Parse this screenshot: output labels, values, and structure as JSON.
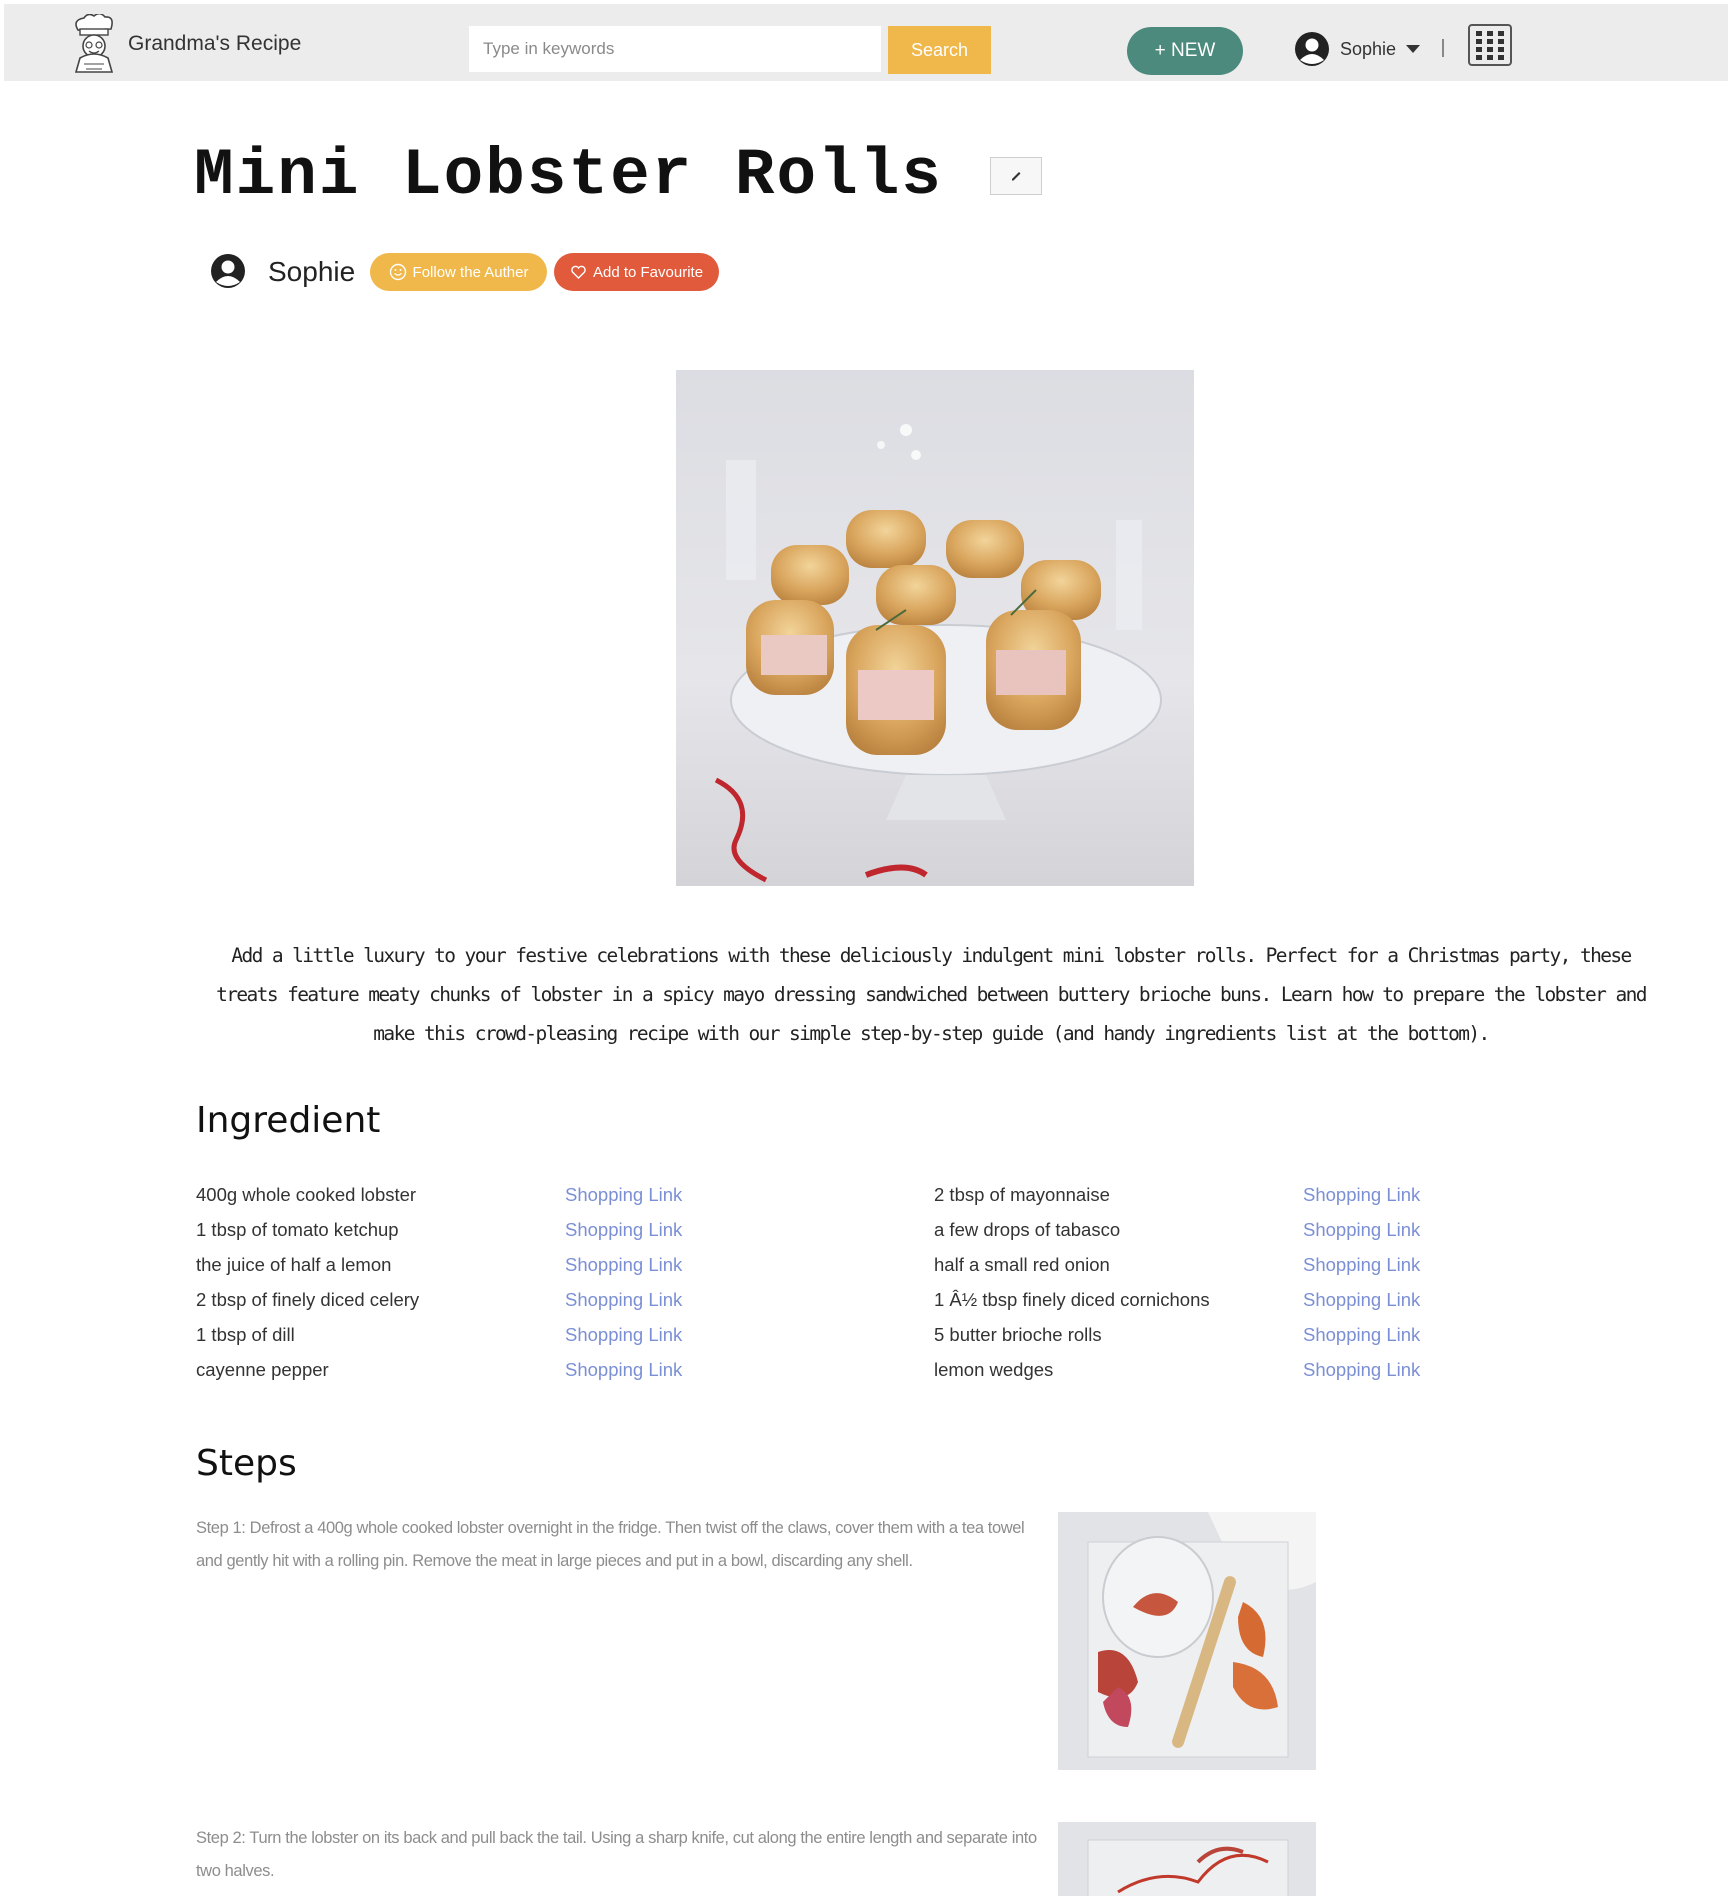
{
  "header": {
    "brand": "Grandma's Recipe",
    "search_placeholder": "Type in keywords",
    "search_label": "Search",
    "new_label": "+ NEW",
    "user_name": "Sophie"
  },
  "recipe": {
    "title": "Mini Lobster Rolls",
    "author": "Sophie",
    "follow_label": "Follow the Auther",
    "favourite_label": "Add to Favourite",
    "description": "Add a little luxury to your festive celebrations with these deliciously indulgent mini lobster rolls. Perfect for a Christmas party, these treats feature meaty chunks of lobster in a spicy mayo dressing sandwiched between buttery brioche buns. Learn how to prepare the lobster and make this crowd-pleasing recipe with our simple step-by-step guide (and handy ingredients list at the bottom)."
  },
  "ingredients": {
    "heading": "Ingredient",
    "link_label": "Shopping Link",
    "left": [
      "400g whole cooked lobster",
      "1 tbsp of tomato ketchup",
      "the juice of half a lemon",
      "2 tbsp of finely diced celery",
      "1 tbsp of dill",
      "cayenne pepper"
    ],
    "right": [
      "2 tbsp of mayonnaise",
      "a few drops of tabasco",
      "half a small red onion",
      "1 Â½ tbsp finely diced cornichons",
      "5 butter brioche rolls",
      "lemon wedges"
    ]
  },
  "steps": {
    "heading": "Steps",
    "items": [
      "Step 1: Defrost a 400g whole cooked lobster overnight in the fridge. Then twist off the claws, cover them with a tea towel and gently hit with a rolling pin. Remove the meat in large pieces and put in a bowl, discarding any shell.",
      "Step 2: Turn the lobster on its back and pull back the tail. Using a sharp knife, cut along the entire length and separate into two halves."
    ]
  },
  "colors": {
    "header_bg": "#ececec",
    "search_button": "#f0b84a",
    "new_button": "#4b8a7c",
    "follow_button": "#f0b84a",
    "favourite_button": "#e05a3b",
    "link": "#7b8fd4"
  },
  "icons": {
    "logo": "chef-grandma-logo",
    "user": "user-avatar-icon",
    "caret": "caret-down-icon",
    "apps": "grid-apps-icon",
    "edit": "pencil-edit-icon",
    "follow": "smiley-icon",
    "favourite": "heart-icon"
  }
}
